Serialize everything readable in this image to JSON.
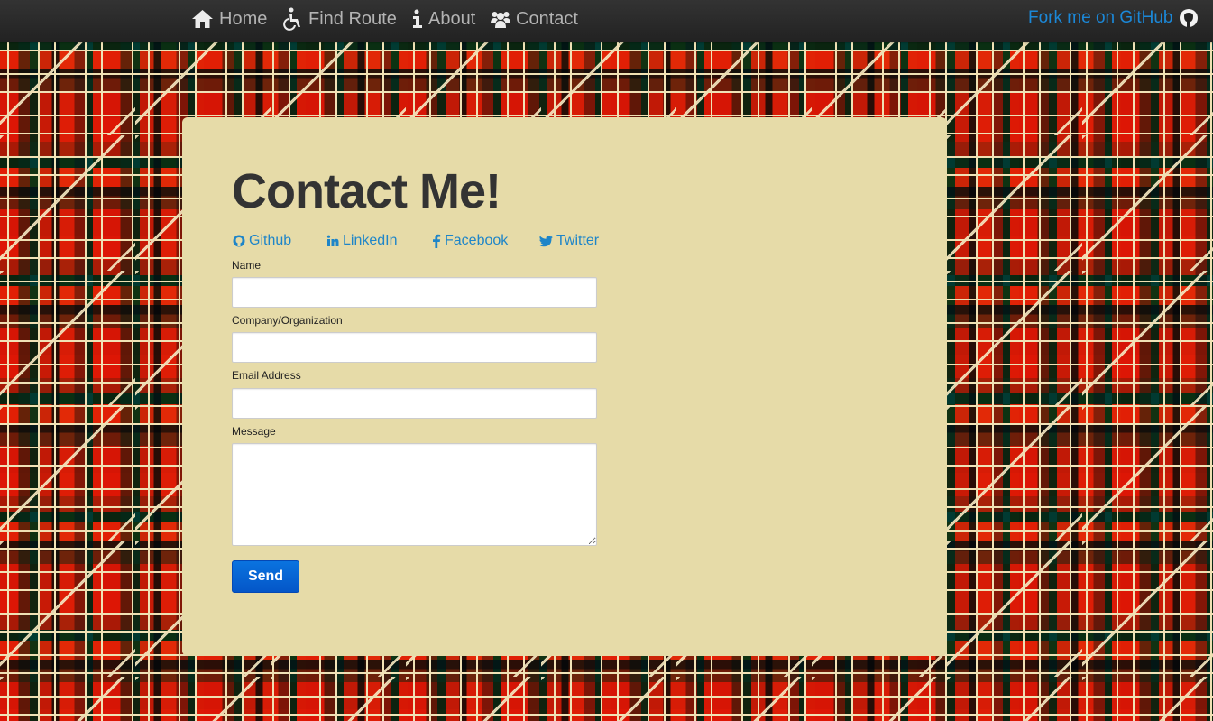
{
  "nav": {
    "items": [
      {
        "label": "Home",
        "icon": "home-icon"
      },
      {
        "label": "Find Route",
        "icon": "wheelchair-icon"
      },
      {
        "label": "About",
        "icon": "info-icon"
      },
      {
        "label": "Contact",
        "icon": "group-icon"
      }
    ],
    "fork": {
      "label": "Fork me on GitHub",
      "icon": "github-icon"
    }
  },
  "contact": {
    "title": "Contact Me!",
    "social": [
      {
        "label": "Github",
        "icon": "github-icon"
      },
      {
        "label": "LinkedIn",
        "icon": "linkedin-icon"
      },
      {
        "label": "Facebook",
        "icon": "facebook-icon"
      },
      {
        "label": "Twitter",
        "icon": "twitter-icon"
      }
    ],
    "form": {
      "name_label": "Name",
      "name_value": "",
      "company_label": "Company/Organization",
      "company_value": "",
      "email_label": "Email Address",
      "email_value": "",
      "message_label": "Message",
      "message_value": "",
      "send_label": "Send"
    }
  },
  "colors": {
    "navbar": "#222222",
    "panel": "#e6dba8",
    "link": "#1e85c8",
    "button": "#0456c8"
  }
}
